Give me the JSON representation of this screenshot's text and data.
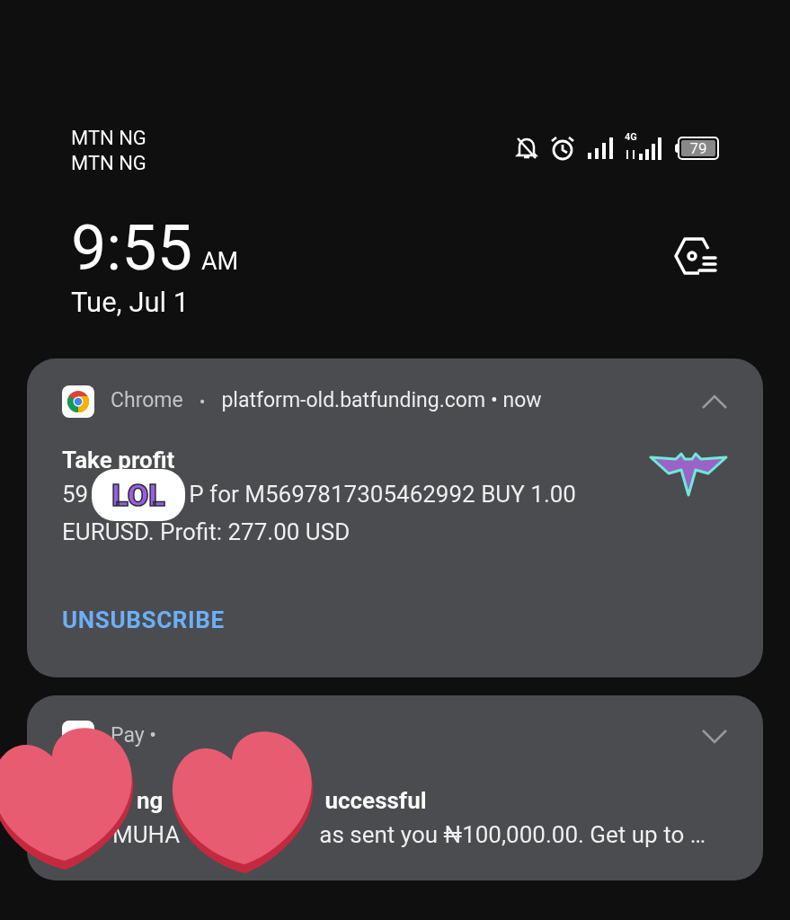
{
  "status_bar": {
    "carriers": [
      "MTN NG",
      "MTN NG"
    ],
    "network": "4G",
    "battery": "79"
  },
  "clock": {
    "time": "9:55",
    "ampm": "AM",
    "date": "Tue, Jul 1"
  },
  "notifications": [
    {
      "kind": "web",
      "app": "Chrome",
      "separator": "•",
      "source": "platform-old.batfunding.com",
      "time": "• now",
      "expanded": true,
      "title": [
        "Take profit"
      ],
      "body_lines": [
        [
          "59",
          "P for M5697817305462992 BUY 1.00"
        ],
        [
          "EURUSD. Profit: 277.00 USD"
        ]
      ],
      "action": "UNSUBSCRIBE"
    },
    {
      "kind": "pay",
      "app": "Pay •",
      "expanded": false,
      "title": [
        "ng",
        "uccessful"
      ],
      "body_lines": [
        [
          "MUHA",
          "as sent you ₦100,000.00. Get up to …"
        ]
      ]
    }
  ],
  "stickers": [
    {
      "kind": "speech",
      "text": "LOL"
    },
    {
      "kind": "heart"
    },
    {
      "kind": "heart"
    }
  ]
}
